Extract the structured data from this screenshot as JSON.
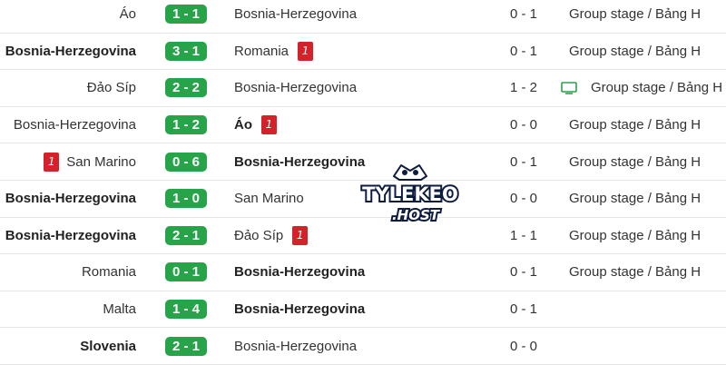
{
  "matches": [
    {
      "home": "Áo",
      "home_bold": false,
      "home_red": "",
      "score": "1 - 1",
      "away": "Bosnia-Herzegovina",
      "away_bold": false,
      "away_red": "",
      "ht": "0 - 1",
      "stage": "Group stage / Bảng H",
      "tv": false
    },
    {
      "home": "Bosnia-Herzegovina",
      "home_bold": true,
      "home_red": "",
      "score": "3 - 1",
      "away": "Romania",
      "away_bold": false,
      "away_red": "1",
      "ht": "0 - 1",
      "stage": "Group stage / Bảng H",
      "tv": false
    },
    {
      "home": "Đảo Síp",
      "home_bold": false,
      "home_red": "",
      "score": "2 - 2",
      "away": "Bosnia-Herzegovina",
      "away_bold": false,
      "away_red": "",
      "ht": "1 - 2",
      "stage": "Group stage / Bảng H",
      "tv": true
    },
    {
      "home": "Bosnia-Herzegovina",
      "home_bold": false,
      "home_red": "",
      "score": "1 - 2",
      "away": "Áo",
      "away_bold": true,
      "away_red": "1",
      "ht": "0 - 0",
      "stage": "Group stage / Bảng H",
      "tv": false
    },
    {
      "home": "San Marino",
      "home_bold": false,
      "home_red": "1",
      "score": "0 - 6",
      "away": "Bosnia-Herzegovina",
      "away_bold": true,
      "away_red": "",
      "ht": "0 - 1",
      "stage": "Group stage / Bảng H",
      "tv": false
    },
    {
      "home": "Bosnia-Herzegovina",
      "home_bold": true,
      "home_red": "",
      "score": "1 - 0",
      "away": "San Marino",
      "away_bold": false,
      "away_red": "",
      "ht": "0 - 0",
      "stage": "Group stage / Bảng H",
      "tv": false
    },
    {
      "home": "Bosnia-Herzegovina",
      "home_bold": true,
      "home_red": "",
      "score": "2 - 1",
      "away": "Đảo Síp",
      "away_bold": false,
      "away_red": "1",
      "ht": "1 - 1",
      "stage": "Group stage / Bảng H",
      "tv": false
    },
    {
      "home": "Romania",
      "home_bold": false,
      "home_red": "",
      "score": "0 - 1",
      "away": "Bosnia-Herzegovina",
      "away_bold": true,
      "away_red": "",
      "ht": "0 - 1",
      "stage": "Group stage / Bảng H",
      "tv": false
    },
    {
      "home": "Malta",
      "home_bold": false,
      "home_red": "",
      "score": "1 - 4",
      "away": "Bosnia-Herzegovina",
      "away_bold": true,
      "away_red": "",
      "ht": "0 - 1",
      "stage": "",
      "tv": false
    },
    {
      "home": "Slovenia",
      "home_bold": true,
      "home_red": "",
      "score": "2 - 1",
      "away": "Bosnia-Herzegovina",
      "away_bold": false,
      "away_red": "",
      "ht": "0 - 0",
      "stage": "",
      "tv": false
    }
  ],
  "icons": {
    "tv": "tv-icon",
    "red_card": "red-card-icon"
  },
  "colors": {
    "score_badge": "#27a34a",
    "red_card": "#d3222a",
    "tv_icon": "#2aa24a",
    "watermark_text": "#ffffff",
    "watermark_outline": "#0d1b3f"
  },
  "watermark": {
    "line1": "TYLEKEO",
    "line2": ".HOST"
  }
}
